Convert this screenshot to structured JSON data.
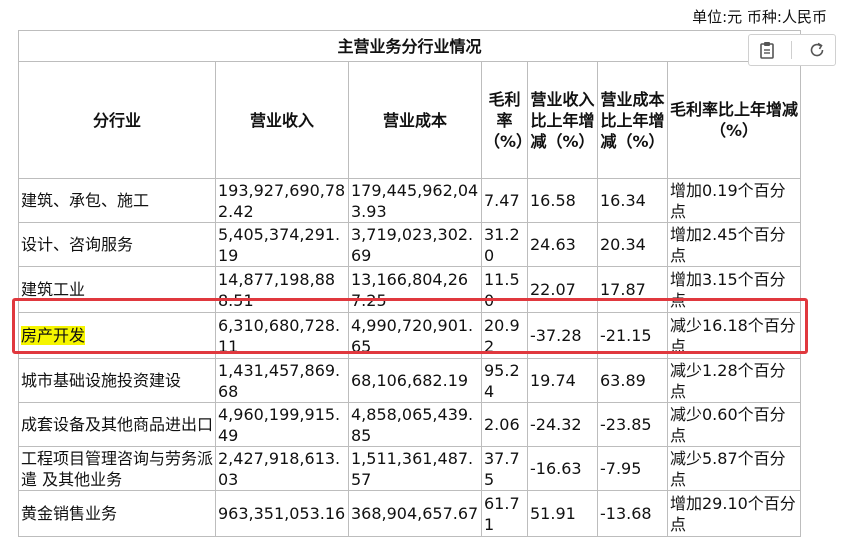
{
  "unit_label": "单位:元 币种:人民币",
  "table": {
    "caption": "主营业务分行业情况",
    "headers": [
      "分行业",
      "营业收入",
      "营业成本",
      "毛利率（%）",
      "营业收入比上年增减（%）",
      "营业成本比上年增减（%）",
      "毛利率比上年增减（%）"
    ],
    "rows": [
      {
        "industry": "建筑、承包、施工",
        "revenue": "193,927,690,782.42",
        "cost": "179,445,962,043.93",
        "margin": "7.47",
        "rev_chg": "16.58",
        "cost_chg": "16.34",
        "margin_chg": "增加0.19个百分点"
      },
      {
        "industry": "设计、咨询服务",
        "revenue": "5,405,374,291.19",
        "cost": "3,719,023,302.69",
        "margin": "31.20",
        "rev_chg": "24.63",
        "cost_chg": "20.34",
        "margin_chg": "增加2.45个百分点"
      },
      {
        "industry": "建筑工业",
        "revenue": "14,877,198,888.51",
        "cost": "13,166,804,267.25",
        "margin": "11.50",
        "rev_chg": "22.07",
        "cost_chg": "17.87",
        "margin_chg": "增加3.15个百分点"
      },
      {
        "industry": "房产开发",
        "revenue": "6,310,680,728.11",
        "cost": "4,990,720,901.65",
        "margin": "20.92",
        "rev_chg": "-37.28",
        "cost_chg": "-21.15",
        "margin_chg": "减少16.18个百分点"
      },
      {
        "industry": "城市基础设施投资建设",
        "revenue": "1,431,457,869.68",
        "cost": "68,106,682.19",
        "margin": "95.24",
        "rev_chg": "19.74",
        "cost_chg": "63.89",
        "margin_chg": "减少1.28个百分点"
      },
      {
        "industry": "成套设备及其他商品进出口",
        "revenue": "4,960,199,915.49",
        "cost": "4,858,065,439.85",
        "margin": "2.06",
        "rev_chg": "-24.32",
        "cost_chg": "-23.85",
        "margin_chg": "减少0.60个百分点"
      },
      {
        "industry": "工程项目管理咨询与劳务派遣 及其他业务",
        "revenue": "2,427,918,613.03",
        "cost": "1,511,361,487.57",
        "margin": "37.75",
        "rev_chg": "-16.63",
        "cost_chg": "-7.95",
        "margin_chg": "减少5.87个百分点"
      },
      {
        "industry": "黄金销售业务",
        "revenue": "963,351,053.16",
        "cost": "368,904,657.67",
        "margin": "61.71",
        "rev_chg": "51.91",
        "cost_chg": "-13.68",
        "margin_chg": "增加29.10个百分点"
      }
    ]
  },
  "toolbar": {
    "copy_icon": "clipboard-icon",
    "refresh_icon": "refresh-icon"
  },
  "highlight_row_index": 3,
  "colors": {
    "highlight": "#f5f500",
    "callout_border": "#e0383e"
  }
}
